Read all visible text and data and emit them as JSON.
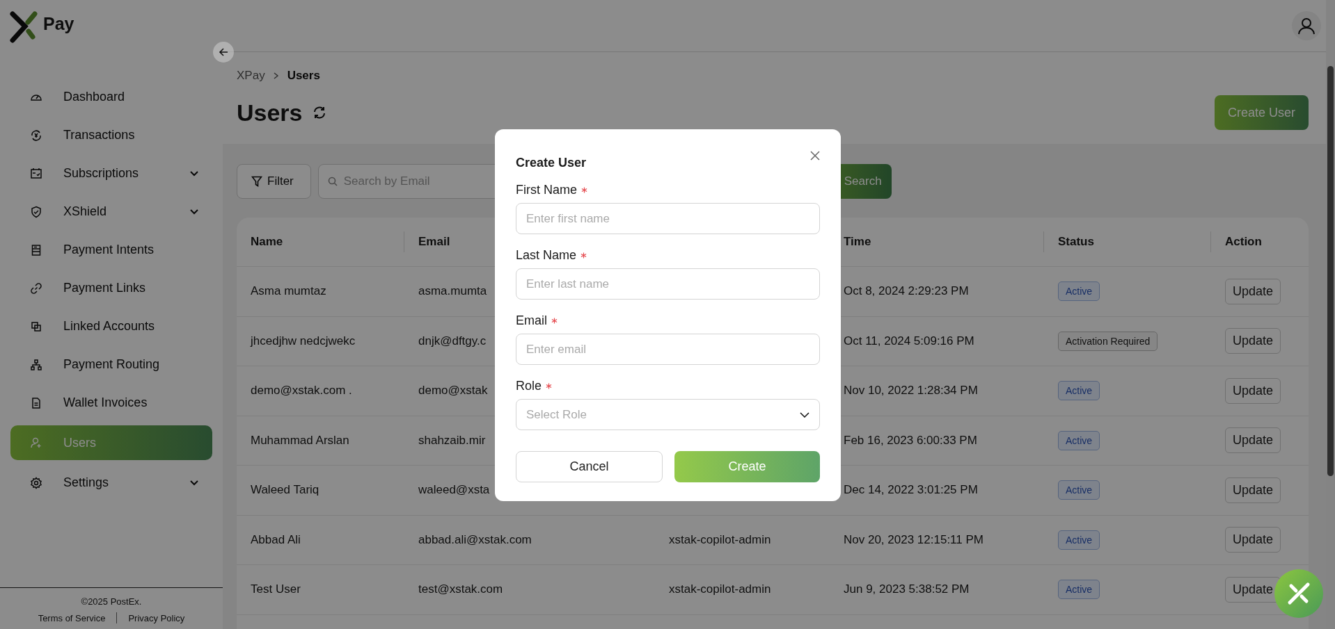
{
  "brand": {
    "name": "Pay"
  },
  "sidebar": {
    "items": [
      {
        "label": "Dashboard",
        "selected": false,
        "expandable": false
      },
      {
        "label": "Transactions",
        "selected": false,
        "expandable": false
      },
      {
        "label": "Subscriptions",
        "selected": false,
        "expandable": true
      },
      {
        "label": "XShield",
        "selected": false,
        "expandable": true
      },
      {
        "label": "Payment Intents",
        "selected": false,
        "expandable": false
      },
      {
        "label": "Payment Links",
        "selected": false,
        "expandable": false
      },
      {
        "label": "Linked Accounts",
        "selected": false,
        "expandable": false
      },
      {
        "label": "Payment Routing",
        "selected": false,
        "expandable": false
      },
      {
        "label": "Wallet Invoices",
        "selected": false,
        "expandable": false
      },
      {
        "label": "Users",
        "selected": true,
        "expandable": false
      },
      {
        "label": "Settings",
        "selected": false,
        "expandable": true
      }
    ],
    "footer": {
      "copyright": "©2025 PostEx.",
      "links": [
        "Terms of Service",
        "Privacy Policy"
      ]
    }
  },
  "breadcrumb": [
    "XPay",
    "Users"
  ],
  "page": {
    "title": "Users",
    "create_button": "Create User"
  },
  "toolbar": {
    "filter": "Filter",
    "search_placeholder": "Search by Email",
    "search_button": "Search"
  },
  "table": {
    "columns": [
      "Name",
      "Email",
      "Time",
      "Status",
      "Action"
    ],
    "rows": [
      {
        "name": "Asma mumtaz",
        "email": "asma.mumta",
        "time": "Oct 8, 2024 2:29:23 PM",
        "status": {
          "label": "Active",
          "kind": "active"
        },
        "action": "Update"
      },
      {
        "name": "jhcedjhw nedcjwekc",
        "email": "dnjk@dftgy.c",
        "time": "Oct 11, 2024 5:09:16 PM",
        "status": {
          "label": "Activation Required",
          "kind": "pending"
        },
        "action": "Update"
      },
      {
        "name": "demo@xstak.com .",
        "email": "demo@xstak",
        "time": "Nov 10, 2022 1:28:34 PM",
        "status": {
          "label": "Active",
          "kind": "active"
        },
        "action": "Update"
      },
      {
        "name": "Muhammad Arslan",
        "email": "shahzaib.mir",
        "time": "Feb 16, 2023 6:00:33 PM",
        "status": {
          "label": "Active",
          "kind": "active"
        },
        "action": "Update"
      },
      {
        "name": "Waleed Tariq",
        "email": "waleed@xsta",
        "time": "Dec 14, 2022 3:01:25 PM",
        "status": {
          "label": "Active",
          "kind": "active"
        },
        "action": "Update"
      },
      {
        "name": "Abbad Ali",
        "email": "abbad.ali@xstak.com",
        "role": "xstak-copilot-admin",
        "time": "Nov 20, 2023 12:15:11 PM",
        "status": {
          "label": "Active",
          "kind": "active"
        },
        "action": "Update"
      },
      {
        "name": "Test User",
        "email": "test@xstak.com",
        "role": "xstak-copilot-admin",
        "time": "Jun 9, 2023 5:38:52 PM",
        "status": {
          "label": "Active",
          "kind": "active"
        },
        "action": "Update"
      }
    ]
  },
  "modal": {
    "title": "Create User",
    "fields": [
      {
        "label": "First Name",
        "required": true,
        "placeholder": "Enter first name",
        "kind": "text"
      },
      {
        "label": "Last Name",
        "required": true,
        "placeholder": "Enter last name",
        "kind": "text"
      },
      {
        "label": "Email",
        "required": true,
        "placeholder": "Enter email",
        "kind": "text"
      },
      {
        "label": "Role",
        "required": true,
        "placeholder": "Select Role",
        "kind": "select"
      }
    ],
    "cancel": "Cancel",
    "submit": "Create"
  }
}
